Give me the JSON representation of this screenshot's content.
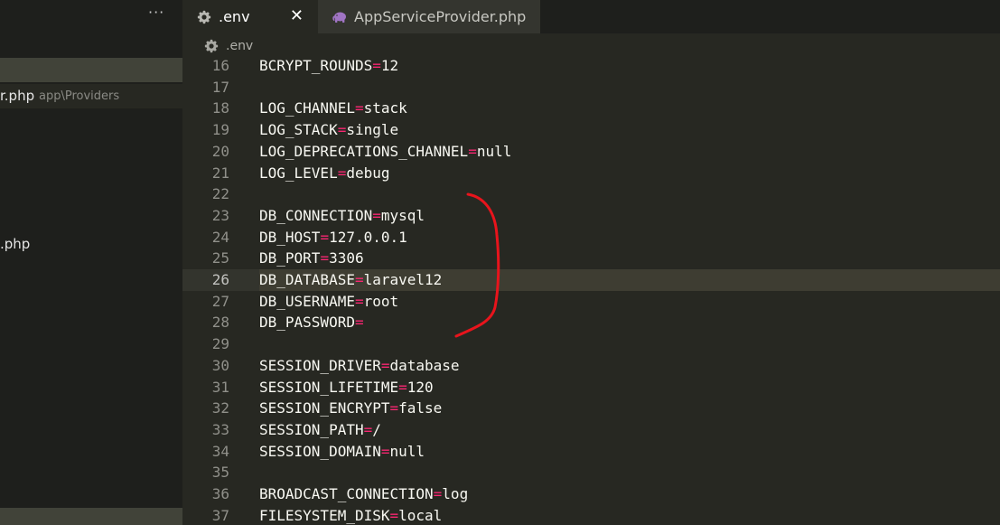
{
  "sidebar": {
    "more_label": "···",
    "active_item": {
      "name": "r.php",
      "path": "app\\Providers"
    },
    "file_item": ".php"
  },
  "tabs": [
    {
      "label": ".env",
      "icon": "gear-icon",
      "active": true,
      "close": "✕"
    },
    {
      "label": "AppServiceProvider.php",
      "icon": "php-elephant-icon",
      "active": false
    }
  ],
  "breadcrumb": {
    "label": ".env",
    "icon": "gear-icon"
  },
  "editor": {
    "current_line": 26,
    "lines": [
      {
        "n": "16",
        "key": "BCRYPT_ROUNDS",
        "eq": "=",
        "val": "12"
      },
      {
        "n": "17",
        "key": "",
        "eq": "",
        "val": ""
      },
      {
        "n": "18",
        "key": "LOG_CHANNEL",
        "eq": "=",
        "val": "stack"
      },
      {
        "n": "19",
        "key": "LOG_STACK",
        "eq": "=",
        "val": "single"
      },
      {
        "n": "20",
        "key": "LOG_DEPRECATIONS_CHANNEL",
        "eq": "=",
        "val": "null"
      },
      {
        "n": "21",
        "key": "LOG_LEVEL",
        "eq": "=",
        "val": "debug"
      },
      {
        "n": "22",
        "key": "",
        "eq": "",
        "val": ""
      },
      {
        "n": "23",
        "key": "DB_CONNECTION",
        "eq": "=",
        "val": "mysql"
      },
      {
        "n": "24",
        "key": "DB_HOST",
        "eq": "=",
        "val": "127.0.0.1"
      },
      {
        "n": "25",
        "key": "DB_PORT",
        "eq": "=",
        "val": "3306"
      },
      {
        "n": "26",
        "key": "DB_DATABASE",
        "eq": "=",
        "val": "laravel12"
      },
      {
        "n": "27",
        "key": "DB_USERNAME",
        "eq": "=",
        "val": "root"
      },
      {
        "n": "28",
        "key": "DB_PASSWORD",
        "eq": "=",
        "val": ""
      },
      {
        "n": "29",
        "key": "",
        "eq": "",
        "val": ""
      },
      {
        "n": "30",
        "key": "SESSION_DRIVER",
        "eq": "=",
        "val": "database"
      },
      {
        "n": "31",
        "key": "SESSION_LIFETIME",
        "eq": "=",
        "val": "120"
      },
      {
        "n": "32",
        "key": "SESSION_ENCRYPT",
        "eq": "=",
        "val": "false"
      },
      {
        "n": "33",
        "key": "SESSION_PATH",
        "eq": "=",
        "val": "/"
      },
      {
        "n": "34",
        "key": "SESSION_DOMAIN",
        "eq": "=",
        "val": "null"
      },
      {
        "n": "35",
        "key": "",
        "eq": "",
        "val": ""
      },
      {
        "n": "36",
        "key": "BROADCAST_CONNECTION",
        "eq": "=",
        "val": "log"
      },
      {
        "n": "37",
        "key": "FILESYSTEM_DISK",
        "eq": "=",
        "val": "local"
      }
    ]
  },
  "colors": {
    "annotation_stroke": "#e8141c",
    "equals_sign": "#f92672"
  }
}
